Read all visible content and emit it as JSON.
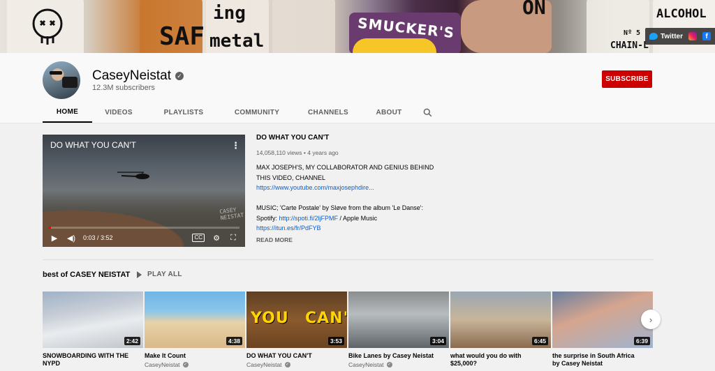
{
  "banner": {
    "scrawls": [
      "SAF",
      "ing",
      "metal",
      "SMUCKER'S",
      "ON",
      "ALCOHOL",
      "Nº 5",
      "CHAIN-L"
    ],
    "social": {
      "twitter_label": "Twitter"
    }
  },
  "channel": {
    "name": "CaseyNeistat",
    "verified_mark": "✓",
    "subscribers": "12.3M subscribers",
    "subscribe_label": "SUBSCRIBE"
  },
  "tabs": [
    "HOME",
    "VIDEOS",
    "PLAYLISTS",
    "COMMUNITY",
    "CHANNELS",
    "ABOUT"
  ],
  "featured": {
    "title": "DO WHAT YOU CAN'T",
    "player_title": "DO WHAT YOU CAN'T",
    "watermark": "CASEY NEISTAT",
    "more_icon": "⋮",
    "time": "0:03 / 3:52",
    "progress_fraction": 0.013,
    "cc_label": "CC",
    "views": "14,058,110 views",
    "age": "4 years ago",
    "description_line1": "MAX JOSEPH'S, MY COLLABORATOR AND GENIUS BEHIND",
    "description_line2": "THIS VIDEO, CHANNEL",
    "link1": "https://www.youtube.com/maxjosephdire...",
    "music_line": "MUSIC; 'Carte Postale' by Sløve from the album 'Le Danse':",
    "spotify_prefix": "Spotify: ",
    "spotify_link": "http://spoti.fi/2ljFPMF",
    "spotify_suffix": " / Apple Music",
    "link3": "https://itun.es/fr/PdFYB",
    "read_more": "READ MORE"
  },
  "shelf": {
    "title": "best of CASEY NEISTAT",
    "play_all": "PLAY ALL",
    "next_icon": "›",
    "videos": [
      {
        "title": "SNOWBOARDING WITH THE",
        "title2": "NYPD",
        "channel": "",
        "duration": "2:42",
        "thumb": "t1"
      },
      {
        "title": "Make It Count",
        "title2": "",
        "channel": "CaseyNeistat",
        "duration": "4:38",
        "thumb": "t2"
      },
      {
        "title": "DO WHAT YOU CAN'T",
        "title2": "",
        "channel": "CaseyNeistat",
        "duration": "3:53",
        "thumb": "t3",
        "overlay_left": "YOU",
        "overlay_right": "CAN'T"
      },
      {
        "title": "Bike Lanes by Casey Neistat",
        "title2": "",
        "channel": "CaseyNeistat",
        "duration": "3:04",
        "thumb": "t4"
      },
      {
        "title": "what would you do with",
        "title2": "$25,000?",
        "channel": "",
        "duration": "6:45",
        "thumb": "t5"
      },
      {
        "title": "the surprise in South Africa",
        "title2": "by Casey Neistat",
        "channel": "",
        "duration": "6:39",
        "thumb": "t6"
      }
    ]
  },
  "colors": {
    "subscribe": "#cc0000",
    "link": "#065fd4",
    "progress": "#ff0000"
  }
}
